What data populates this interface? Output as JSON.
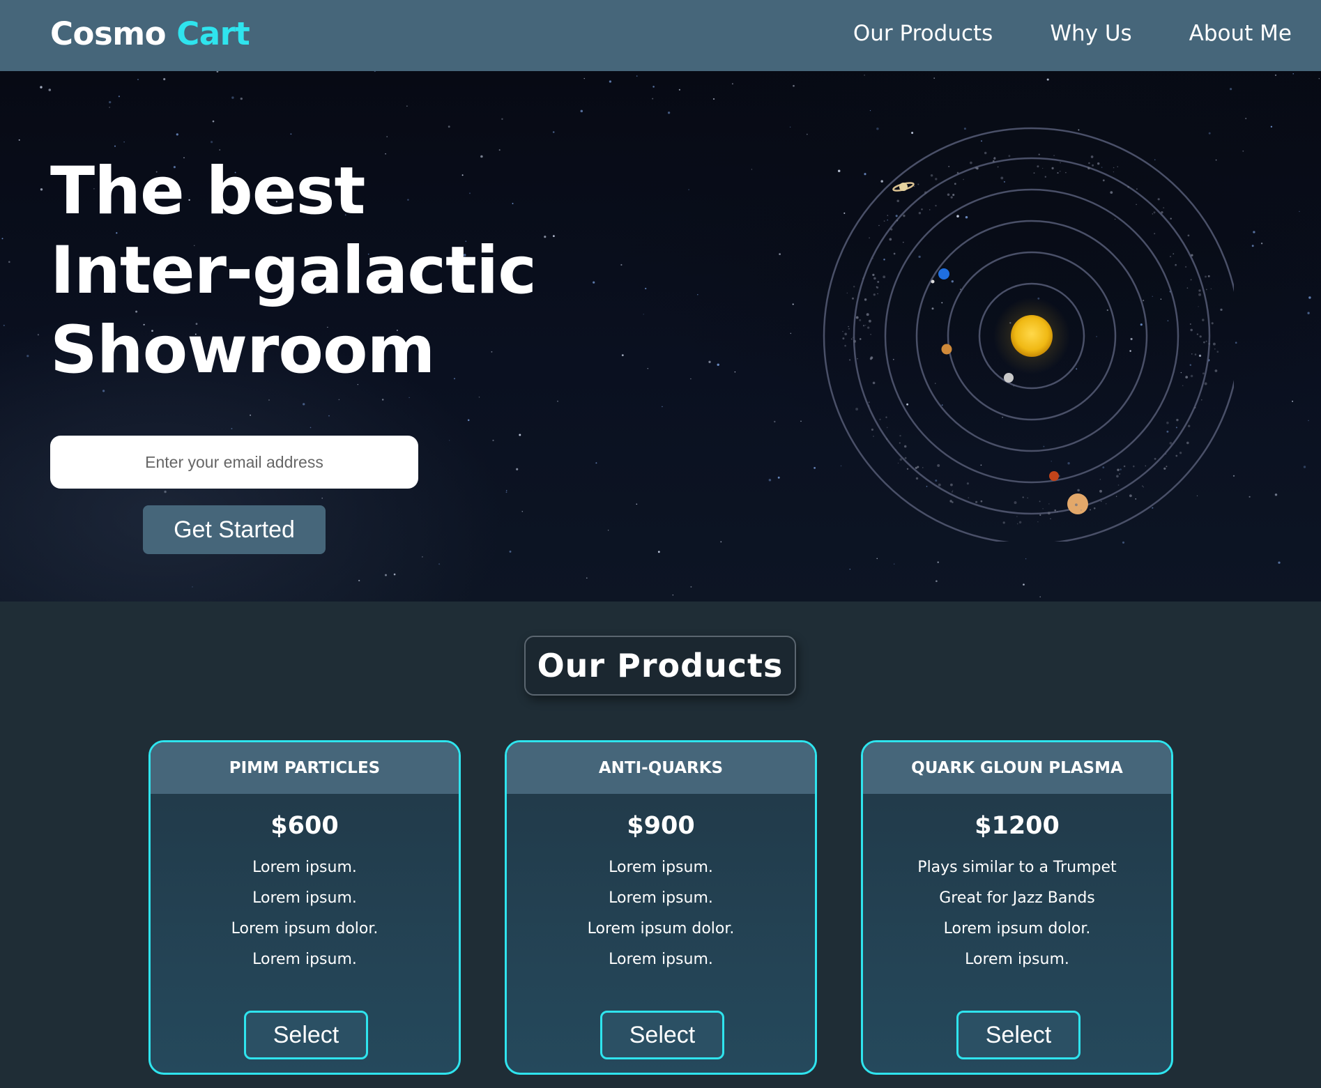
{
  "colors": {
    "accent": "#2fe4ee",
    "header": "#46667a",
    "page_bg": "#1f2d36"
  },
  "header": {
    "logo_primary": "Cosmo ",
    "logo_accent": "Cart",
    "nav": [
      {
        "label": "Our Products"
      },
      {
        "label": "Why Us"
      },
      {
        "label": "About Me"
      }
    ]
  },
  "hero": {
    "title_lines": [
      "The best",
      "Inter-galactic",
      "Showroom"
    ],
    "email_placeholder": "Enter your email address",
    "cta_label": "Get Started",
    "illustration": "solar-system"
  },
  "products": {
    "heading": "Our Products",
    "cards": [
      {
        "name": "PIMM PARTICLES",
        "price": "$600",
        "features": [
          "Lorem ipsum.",
          "Lorem ipsum.",
          "Lorem ipsum dolor.",
          "Lorem ipsum."
        ],
        "button_label": "Select"
      },
      {
        "name": "ANTI-QUARKS",
        "price": "$900",
        "features": [
          "Lorem ipsum.",
          "Lorem ipsum.",
          "Lorem ipsum dolor.",
          "Lorem ipsum."
        ],
        "button_label": "Select"
      },
      {
        "name": "QUARK GLOUN PLASMA",
        "price": "$1200",
        "features": [
          "Plays similar to a Trumpet",
          "Great for Jazz Bands",
          "Lorem ipsum dolor.",
          "Lorem ipsum."
        ],
        "button_label": "Select"
      }
    ]
  }
}
